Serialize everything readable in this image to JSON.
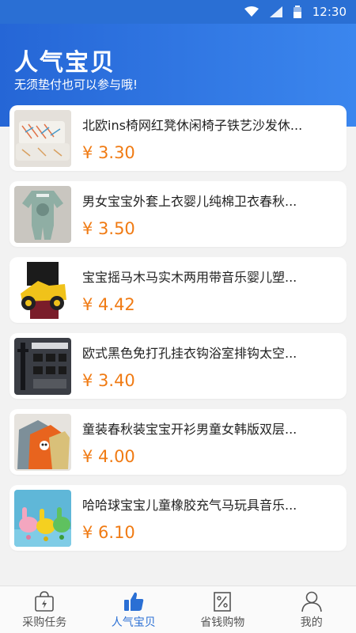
{
  "status_bar": {
    "time": "12:30"
  },
  "header": {
    "title": "人气宝贝",
    "subtitle": "无须垫付也可以参与哦!"
  },
  "products": [
    {
      "title": "北欧ins椅网红凳休闲椅子铁艺沙发休...",
      "price": "¥ 3.30"
    },
    {
      "title": "男女宝宝外套上衣婴儿纯棉卫衣春秋...",
      "price": "¥ 3.50"
    },
    {
      "title": "宝宝摇马木马实木两用带音乐婴儿塑...",
      "price": "¥ 4.42"
    },
    {
      "title": "欧式黑色免打孔挂衣钩浴室排钩太空...",
      "price": "¥ 3.40"
    },
    {
      "title": "童装春秋装宝宝开衫男童女韩版双层...",
      "price": "¥ 4.00"
    },
    {
      "title": "哈哈球宝宝儿童橡胶充气马玩具音乐...",
      "price": "¥ 6.10"
    }
  ],
  "tabs": [
    {
      "label": "采购任务",
      "icon": "shopping-bag-icon"
    },
    {
      "label": "人气宝贝",
      "icon": "thumbs-up-icon",
      "active": true
    },
    {
      "label": "省钱购物",
      "icon": "discount-icon"
    },
    {
      "label": "我的",
      "icon": "user-icon"
    }
  ],
  "colors": {
    "primary": "#2a6fd4",
    "price": "#f07b14"
  }
}
